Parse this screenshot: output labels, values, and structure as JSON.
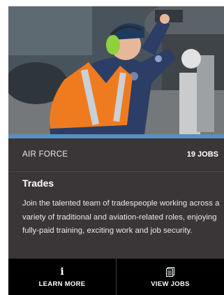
{
  "card": {
    "category": "AIR FORCE",
    "job_count": "19 JOBS",
    "title": "Trades",
    "description": "Join the talented team of tradespeople working across a variety of traditional and aviation-related roles, enjoying fully-paid training, exciting work and job security.",
    "image_alt": "Air Force tradesperson in orange hi-vis vest and green ear protection working on an aircraft"
  },
  "actions": {
    "learn_more": {
      "label": "LEARN MORE",
      "icon": "info-icon"
    },
    "view_jobs": {
      "label": "VIEW JOBS",
      "icon": "document-icon"
    }
  },
  "colors": {
    "card_bg": "#3a3637",
    "button_bg": "#000000",
    "accent": "#5b8ec1",
    "vest": "#f07b1f",
    "ear_protection": "#8fd13d"
  }
}
